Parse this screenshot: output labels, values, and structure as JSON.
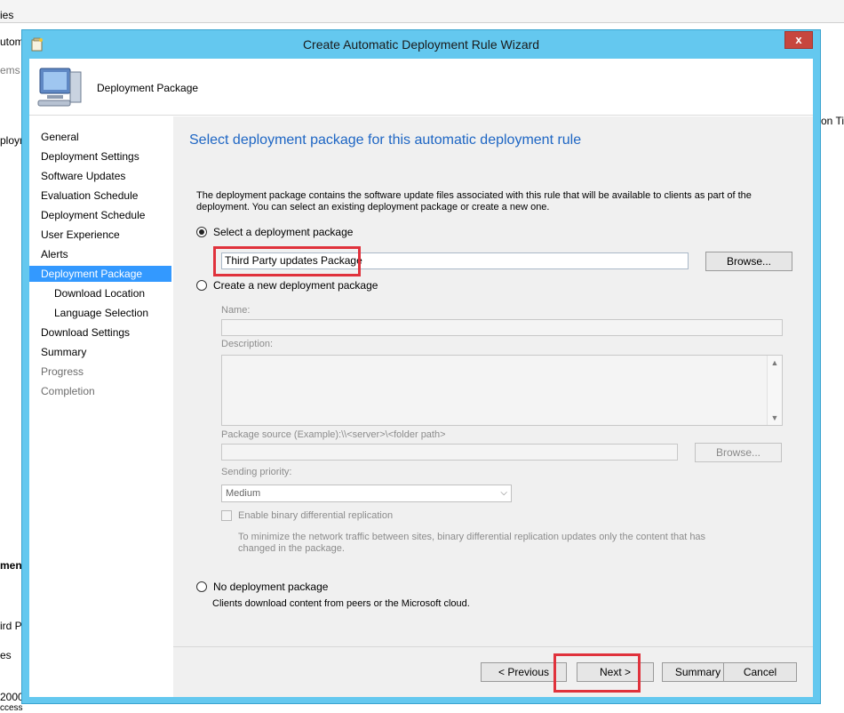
{
  "background": {
    "fragments": [
      "ies",
      "utom",
      "ems",
      "on Ti",
      "ploym",
      "ment",
      "ird P",
      "es",
      "2000",
      "ccess"
    ]
  },
  "dialog": {
    "title": "Create Automatic Deployment Rule Wizard",
    "close_label": "x",
    "header_title": "Deployment Package",
    "nav": [
      {
        "label": "General",
        "state": "normal"
      },
      {
        "label": "Deployment Settings",
        "state": "normal"
      },
      {
        "label": "Software Updates",
        "state": "normal"
      },
      {
        "label": "Evaluation Schedule",
        "state": "normal"
      },
      {
        "label": "Deployment Schedule",
        "state": "normal"
      },
      {
        "label": "User Experience",
        "state": "normal"
      },
      {
        "label": "Alerts",
        "state": "normal"
      },
      {
        "label": "Deployment Package",
        "state": "active"
      },
      {
        "label": "Download Location",
        "state": "sub"
      },
      {
        "label": "Language Selection",
        "state": "sub"
      },
      {
        "label": "Download Settings",
        "state": "normal"
      },
      {
        "label": "Summary",
        "state": "normal"
      },
      {
        "label": "Progress",
        "state": "disabled"
      },
      {
        "label": "Completion",
        "state": "disabled"
      }
    ],
    "content": {
      "heading": "Select deployment package for this automatic deployment rule",
      "description": "The deployment package contains the software update files associated with this rule that will be available to clients as part of the deployment. You can select an existing deployment package or create a new one.",
      "option_select_label": "Select a deployment package",
      "selected_package": "Third Party updates Package",
      "browse_label": "Browse...",
      "option_create_label": "Create a new deployment package",
      "name_label": "Name:",
      "name_value": "",
      "description_label": "Description:",
      "package_source_label": "Package source (Example):\\\\<server>\\<folder path>",
      "package_source_value": "",
      "browse_disabled_label": "Browse...",
      "sending_priority_label": "Sending priority:",
      "sending_priority_value": "Medium",
      "binary_replication_label": "Enable binary differential replication",
      "binary_replication_hint": "To minimize the network traffic between sites, binary differential replication updates only the content that has changed in the package.",
      "option_none_label": "No deployment package",
      "option_none_desc": "Clients download content from peers or the Microsoft cloud.",
      "selected_option": "select"
    },
    "buttons": {
      "previous": "< Previous",
      "next": "Next >",
      "summary": "Summary",
      "cancel": "Cancel"
    }
  },
  "colors": {
    "titlebar": "#64c8ef",
    "close": "#c7463e",
    "nav_active": "#3399ff",
    "heading": "#1e66c4",
    "highlight": "#e0323c"
  }
}
